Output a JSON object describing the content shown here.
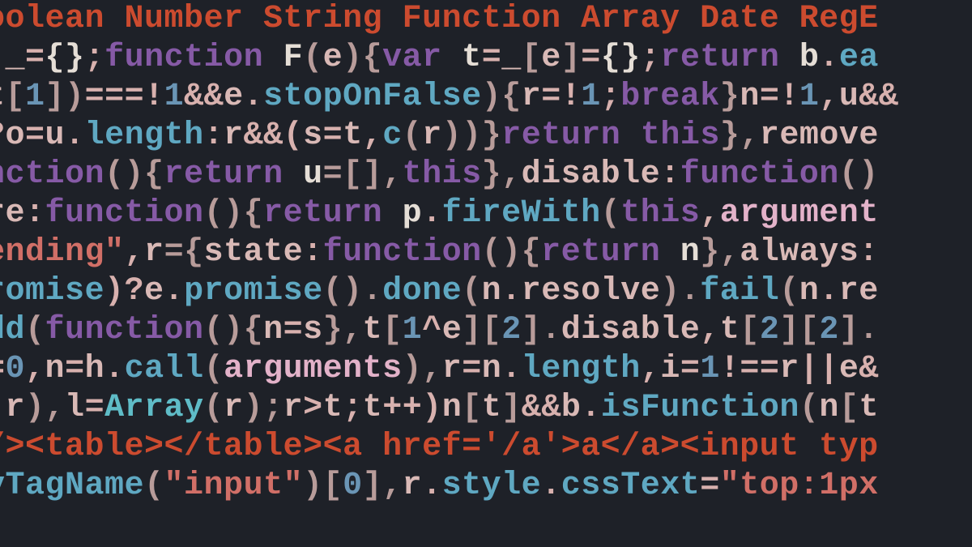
{
  "code": {
    "description": "Cropped view of minified JavaScript (jQuery-style) source with syntax highlighting",
    "background": "#1e2128",
    "font": "monospace",
    "lines": [
      {
        "tokens": [
          {
            "t": "oolean Number String Function Array Date RegE",
            "c": "tk-type"
          }
        ]
      },
      {
        "tokens": [
          {
            "t": " _",
            "c": "tk-id"
          },
          {
            "t": "=",
            "c": "tk-op"
          },
          {
            "t": "{}",
            "c": "tk-white"
          },
          {
            "t": ";",
            "c": "tk-op"
          },
          {
            "t": "function",
            "c": "tk-kw"
          },
          {
            "t": " F",
            "c": "tk-white"
          },
          {
            "t": "(",
            "c": "tk-punc"
          },
          {
            "t": "e",
            "c": "tk-id"
          },
          {
            "t": "){",
            "c": "tk-punc"
          },
          {
            "t": "var",
            "c": "tk-kw"
          },
          {
            "t": " t",
            "c": "tk-white"
          },
          {
            "t": "=",
            "c": "tk-op"
          },
          {
            "t": "_",
            "c": "tk-id"
          },
          {
            "t": "[",
            "c": "tk-punc"
          },
          {
            "t": "e",
            "c": "tk-id"
          },
          {
            "t": "]",
            "c": "tk-punc"
          },
          {
            "t": "=",
            "c": "tk-op"
          },
          {
            "t": "{}",
            "c": "tk-white"
          },
          {
            "t": ";",
            "c": "tk-op"
          },
          {
            "t": "return",
            "c": "tk-kw"
          },
          {
            "t": " b",
            "c": "tk-white"
          },
          {
            "t": ".",
            "c": "tk-op"
          },
          {
            "t": "ea",
            "c": "tk-fn"
          }
        ]
      },
      {
        "tokens": [
          {
            "t": "t",
            "c": "tk-id"
          },
          {
            "t": "[",
            "c": "tk-punc"
          },
          {
            "t": "1",
            "c": "tk-num"
          },
          {
            "t": "])",
            "c": "tk-punc"
          },
          {
            "t": "===!",
            "c": "tk-op"
          },
          {
            "t": "1",
            "c": "tk-num"
          },
          {
            "t": "&&",
            "c": "tk-op"
          },
          {
            "t": "e",
            "c": "tk-id"
          },
          {
            "t": ".",
            "c": "tk-op"
          },
          {
            "t": "stopOnFalse",
            "c": "tk-fn"
          },
          {
            "t": "){",
            "c": "tk-punc"
          },
          {
            "t": "r",
            "c": "tk-id"
          },
          {
            "t": "=!",
            "c": "tk-op"
          },
          {
            "t": "1",
            "c": "tk-num"
          },
          {
            "t": ";",
            "c": "tk-op"
          },
          {
            "t": "break",
            "c": "tk-kw"
          },
          {
            "t": "}",
            "c": "tk-punc"
          },
          {
            "t": "n",
            "c": "tk-id"
          },
          {
            "t": "=!",
            "c": "tk-op"
          },
          {
            "t": "1",
            "c": "tk-num"
          },
          {
            "t": ",",
            "c": "tk-op"
          },
          {
            "t": "u",
            "c": "tk-id"
          },
          {
            "t": "&&",
            "c": "tk-op"
          }
        ]
      },
      {
        "tokens": [
          {
            "t": "?",
            "c": "tk-op"
          },
          {
            "t": "o",
            "c": "tk-id"
          },
          {
            "t": "=",
            "c": "tk-op"
          },
          {
            "t": "u",
            "c": "tk-id"
          },
          {
            "t": ".",
            "c": "tk-op"
          },
          {
            "t": "length",
            "c": "tk-fn"
          },
          {
            "t": ":",
            "c": "tk-op"
          },
          {
            "t": "r",
            "c": "tk-id"
          },
          {
            "t": "&&(",
            "c": "tk-op"
          },
          {
            "t": "s",
            "c": "tk-id"
          },
          {
            "t": "=",
            "c": "tk-op"
          },
          {
            "t": "t",
            "c": "tk-id"
          },
          {
            "t": ",",
            "c": "tk-op"
          },
          {
            "t": "c",
            "c": "tk-fn"
          },
          {
            "t": "(",
            "c": "tk-punc"
          },
          {
            "t": "r",
            "c": "tk-id"
          },
          {
            "t": "))}",
            "c": "tk-punc"
          },
          {
            "t": "return",
            "c": "tk-kw"
          },
          {
            "t": " ",
            "c": "tk-op"
          },
          {
            "t": "this",
            "c": "tk-kw"
          },
          {
            "t": "},",
            "c": "tk-punc"
          },
          {
            "t": "remove",
            "c": "tk-id"
          }
        ]
      },
      {
        "tokens": [
          {
            "t": "nction",
            "c": "tk-kw"
          },
          {
            "t": "(){",
            "c": "tk-punc"
          },
          {
            "t": "return",
            "c": "tk-kw"
          },
          {
            "t": " u",
            "c": "tk-white"
          },
          {
            "t": "=[],",
            "c": "tk-punc"
          },
          {
            "t": "this",
            "c": "tk-kw"
          },
          {
            "t": "},",
            "c": "tk-punc"
          },
          {
            "t": "disable",
            "c": "tk-id"
          },
          {
            "t": ":",
            "c": "tk-op"
          },
          {
            "t": "function",
            "c": "tk-kw"
          },
          {
            "t": "()",
            "c": "tk-punc"
          }
        ]
      },
      {
        "tokens": [
          {
            "t": "re",
            "c": "tk-id"
          },
          {
            "t": ":",
            "c": "tk-op"
          },
          {
            "t": "function",
            "c": "tk-kw"
          },
          {
            "t": "(){",
            "c": "tk-punc"
          },
          {
            "t": "return",
            "c": "tk-kw"
          },
          {
            "t": " p",
            "c": "tk-white"
          },
          {
            "t": ".",
            "c": "tk-op"
          },
          {
            "t": "fireWith",
            "c": "tk-fn"
          },
          {
            "t": "(",
            "c": "tk-punc"
          },
          {
            "t": "this",
            "c": "tk-kw"
          },
          {
            "t": ",",
            "c": "tk-op"
          },
          {
            "t": "argument",
            "c": "tk-pinkb"
          }
        ]
      },
      {
        "tokens": [
          {
            "t": "ending\"",
            "c": "tk-str"
          },
          {
            "t": ",",
            "c": "tk-op"
          },
          {
            "t": "r",
            "c": "tk-id"
          },
          {
            "t": "={",
            "c": "tk-punc"
          },
          {
            "t": "state",
            "c": "tk-id"
          },
          {
            "t": ":",
            "c": "tk-op"
          },
          {
            "t": "function",
            "c": "tk-kw"
          },
          {
            "t": "(){",
            "c": "tk-punc"
          },
          {
            "t": "return",
            "c": "tk-kw"
          },
          {
            "t": " n",
            "c": "tk-white"
          },
          {
            "t": "},",
            "c": "tk-punc"
          },
          {
            "t": "always",
            "c": "tk-id"
          },
          {
            "t": ":",
            "c": "tk-op"
          }
        ]
      },
      {
        "tokens": [
          {
            "t": "romise",
            "c": "tk-fn"
          },
          {
            "t": ")?",
            "c": "tk-op"
          },
          {
            "t": "e",
            "c": "tk-id"
          },
          {
            "t": ".",
            "c": "tk-op"
          },
          {
            "t": "promise",
            "c": "tk-fn"
          },
          {
            "t": "().",
            "c": "tk-punc"
          },
          {
            "t": "done",
            "c": "tk-fn"
          },
          {
            "t": "(",
            "c": "tk-punc"
          },
          {
            "t": "n",
            "c": "tk-id"
          },
          {
            "t": ".",
            "c": "tk-op"
          },
          {
            "t": "resolve",
            "c": "tk-id"
          },
          {
            "t": ").",
            "c": "tk-punc"
          },
          {
            "t": "fail",
            "c": "tk-fn"
          },
          {
            "t": "(",
            "c": "tk-punc"
          },
          {
            "t": "n",
            "c": "tk-id"
          },
          {
            "t": ".",
            "c": "tk-op"
          },
          {
            "t": "re",
            "c": "tk-id"
          }
        ]
      },
      {
        "tokens": [
          {
            "t": "dd",
            "c": "tk-fn"
          },
          {
            "t": "(",
            "c": "tk-punc"
          },
          {
            "t": "function",
            "c": "tk-kw"
          },
          {
            "t": "(){",
            "c": "tk-punc"
          },
          {
            "t": "n",
            "c": "tk-id"
          },
          {
            "t": "=",
            "c": "tk-op"
          },
          {
            "t": "s",
            "c": "tk-id"
          },
          {
            "t": "},",
            "c": "tk-punc"
          },
          {
            "t": "t",
            "c": "tk-id"
          },
          {
            "t": "[",
            "c": "tk-punc"
          },
          {
            "t": "1",
            "c": "tk-num"
          },
          {
            "t": "^",
            "c": "tk-op"
          },
          {
            "t": "e",
            "c": "tk-id"
          },
          {
            "t": "][",
            "c": "tk-punc"
          },
          {
            "t": "2",
            "c": "tk-num"
          },
          {
            "t": "].",
            "c": "tk-punc"
          },
          {
            "t": "disable",
            "c": "tk-id"
          },
          {
            "t": ",",
            "c": "tk-op"
          },
          {
            "t": "t",
            "c": "tk-id"
          },
          {
            "t": "[",
            "c": "tk-punc"
          },
          {
            "t": "2",
            "c": "tk-num"
          },
          {
            "t": "][",
            "c": "tk-punc"
          },
          {
            "t": "2",
            "c": "tk-num"
          },
          {
            "t": "].",
            "c": "tk-punc"
          }
        ]
      },
      {
        "tokens": [
          {
            "t": "=",
            "c": "tk-op"
          },
          {
            "t": "0",
            "c": "tk-num"
          },
          {
            "t": ",",
            "c": "tk-op"
          },
          {
            "t": "n",
            "c": "tk-id"
          },
          {
            "t": "=",
            "c": "tk-op"
          },
          {
            "t": "h",
            "c": "tk-id"
          },
          {
            "t": ".",
            "c": "tk-op"
          },
          {
            "t": "call",
            "c": "tk-fn"
          },
          {
            "t": "(",
            "c": "tk-punc"
          },
          {
            "t": "arguments",
            "c": "tk-pinkb"
          },
          {
            "t": "),",
            "c": "tk-punc"
          },
          {
            "t": "r",
            "c": "tk-id"
          },
          {
            "t": "=",
            "c": "tk-op"
          },
          {
            "t": "n",
            "c": "tk-id"
          },
          {
            "t": ".",
            "c": "tk-op"
          },
          {
            "t": "length",
            "c": "tk-fn"
          },
          {
            "t": ",",
            "c": "tk-op"
          },
          {
            "t": "i",
            "c": "tk-id"
          },
          {
            "t": "=",
            "c": "tk-op"
          },
          {
            "t": "1",
            "c": "tk-num"
          },
          {
            "t": "!==",
            "c": "tk-op"
          },
          {
            "t": "r",
            "c": "tk-id"
          },
          {
            "t": "||",
            "c": "tk-op"
          },
          {
            "t": "e",
            "c": "tk-id"
          },
          {
            "t": "&",
            "c": "tk-op"
          }
        ]
      },
      {
        "tokens": [
          {
            "t": "(",
            "c": "tk-punc"
          },
          {
            "t": "r",
            "c": "tk-id"
          },
          {
            "t": "),",
            "c": "tk-punc"
          },
          {
            "t": "l",
            "c": "tk-id"
          },
          {
            "t": "=",
            "c": "tk-op"
          },
          {
            "t": "Array",
            "c": "tk-cyan"
          },
          {
            "t": "(",
            "c": "tk-punc"
          },
          {
            "t": "r",
            "c": "tk-id"
          },
          {
            "t": ");",
            "c": "tk-punc"
          },
          {
            "t": "r",
            "c": "tk-id"
          },
          {
            "t": ">",
            "c": "tk-op"
          },
          {
            "t": "t",
            "c": "tk-id"
          },
          {
            "t": ";",
            "c": "tk-op"
          },
          {
            "t": "t",
            "c": "tk-id"
          },
          {
            "t": "++)",
            "c": "tk-op"
          },
          {
            "t": "n",
            "c": "tk-id"
          },
          {
            "t": "[",
            "c": "tk-punc"
          },
          {
            "t": "t",
            "c": "tk-id"
          },
          {
            "t": "]",
            "c": "tk-punc"
          },
          {
            "t": "&&",
            "c": "tk-op"
          },
          {
            "t": "b",
            "c": "tk-id"
          },
          {
            "t": ".",
            "c": "tk-op"
          },
          {
            "t": "isFunction",
            "c": "tk-fn"
          },
          {
            "t": "(",
            "c": "tk-punc"
          },
          {
            "t": "n",
            "c": "tk-id"
          },
          {
            "t": "[",
            "c": "tk-punc"
          },
          {
            "t": "t",
            "c": "tk-id"
          }
        ]
      },
      {
        "tokens": [
          {
            "t": "/><table></table><a href='/a'>a</a><input typ",
            "c": "tk-tag"
          }
        ]
      },
      {
        "tokens": [
          {
            "t": "yTagName",
            "c": "tk-fn"
          },
          {
            "t": "(",
            "c": "tk-punc"
          },
          {
            "t": "\"input\"",
            "c": "tk-str"
          },
          {
            "t": ")[",
            "c": "tk-punc"
          },
          {
            "t": "0",
            "c": "tk-num"
          },
          {
            "t": "],",
            "c": "tk-punc"
          },
          {
            "t": "r",
            "c": "tk-id"
          },
          {
            "t": ".",
            "c": "tk-op"
          },
          {
            "t": "style",
            "c": "tk-fn"
          },
          {
            "t": ".",
            "c": "tk-op"
          },
          {
            "t": "cssText",
            "c": "tk-fn"
          },
          {
            "t": "=",
            "c": "tk-op"
          },
          {
            "t": "\"top:1px",
            "c": "tk-str"
          }
        ]
      }
    ]
  }
}
